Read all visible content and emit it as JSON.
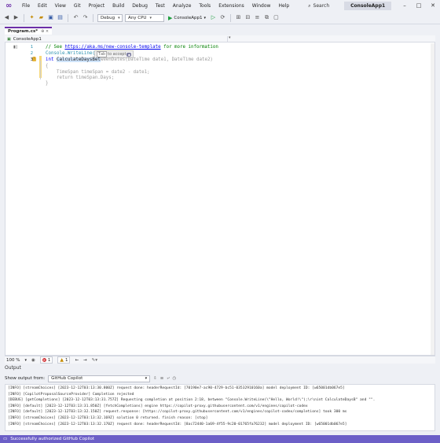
{
  "menu": {
    "items": [
      "File",
      "Edit",
      "View",
      "Git",
      "Project",
      "Build",
      "Debug",
      "Test",
      "Analyze",
      "Tools",
      "Extensions",
      "Window",
      "Help"
    ],
    "search_label": "Search",
    "solution_name": "ConsoleApp1"
  },
  "toolbar": {
    "config": "Debug",
    "platform": "Any CPU",
    "start_label": "ConsoleApp1"
  },
  "tab": {
    "filename": "Program.cs*",
    "pin": "⊕ ×"
  },
  "navbar": {
    "project": "ConsoleApp1"
  },
  "editor": {
    "line_numbers": [
      "1",
      "2",
      "3"
    ],
    "line1_comment_prefix": "// See ",
    "line1_link": "https://aka.ms/new-console-template",
    "line1_comment_suffix": " for more information",
    "line2_code": "Console.WriteLine(\"He",
    "hint_key": "Tab",
    "hint_text": "to accept",
    "line3_kw": "int",
    "line3_sel": "CalculateDaysBet",
    "line3_ghost": "weenDates(DateTime date1, DateTime date2)",
    "ghost_open": "{",
    "ghost_body1": "    TimeSpan timeSpan = date2 - date1;",
    "ghost_body2": "    return timeSpan.Days;",
    "ghost_close": "}"
  },
  "editor_status": {
    "zoom": "100 %",
    "errors": "1",
    "warnings": "1"
  },
  "output": {
    "title": "Output",
    "show_from_label": "Show output from:",
    "source": "GitHub Copilot",
    "lines": [
      "[INFO] [streamChoices] [2023-12-12T03:13:30.800Z] request done: headerRequestId: [70190e7-ac90-4729-bc51-03532910160a] model deployment ID: [w65001db067e5]",
      "[INFO] [CopilotProposalSourceProvider] Completion rejected",
      "[DEBUG] [getCompletions] [2023-12-12T03:13:31.757Z] Requesting completion at position 2:18, between \"Console.WriteLine(\\\"Hello, World!\\\");\\r\\nint CalculateDaysB\" and \"\".",
      "[INFO] [default] [2023-12-12T03:13:31.850Z] [fetchCompletions] engine https://copilot-proxy.githubusercontent.com/v1/engines/copilot-codex",
      "[INFO] [default] [2023-12-12T03:13:32.150Z] request.response: [https://copilot-proxy.githubusercontent.com/v1/engines/copilot-codex/completions] took 300 ms",
      "[INFO] [streamChoices] [2023-12-12T03:13:32.169Z] solution 0 returned. finish reason: [stop]",
      "[INFO] [streamChoices] [2023-12-12T03:13:32.170Z] request done: headerRequestId: [8ac72440-1a69-4f55-9c20-01765fa76232] model deployment ID: [w65001db067e5]"
    ]
  },
  "statusbar": {
    "text": "Successfully authorized GitHub Copilot"
  },
  "colors": {
    "accent": "#6c2ea8",
    "statusbar": "#6c5fc7"
  }
}
